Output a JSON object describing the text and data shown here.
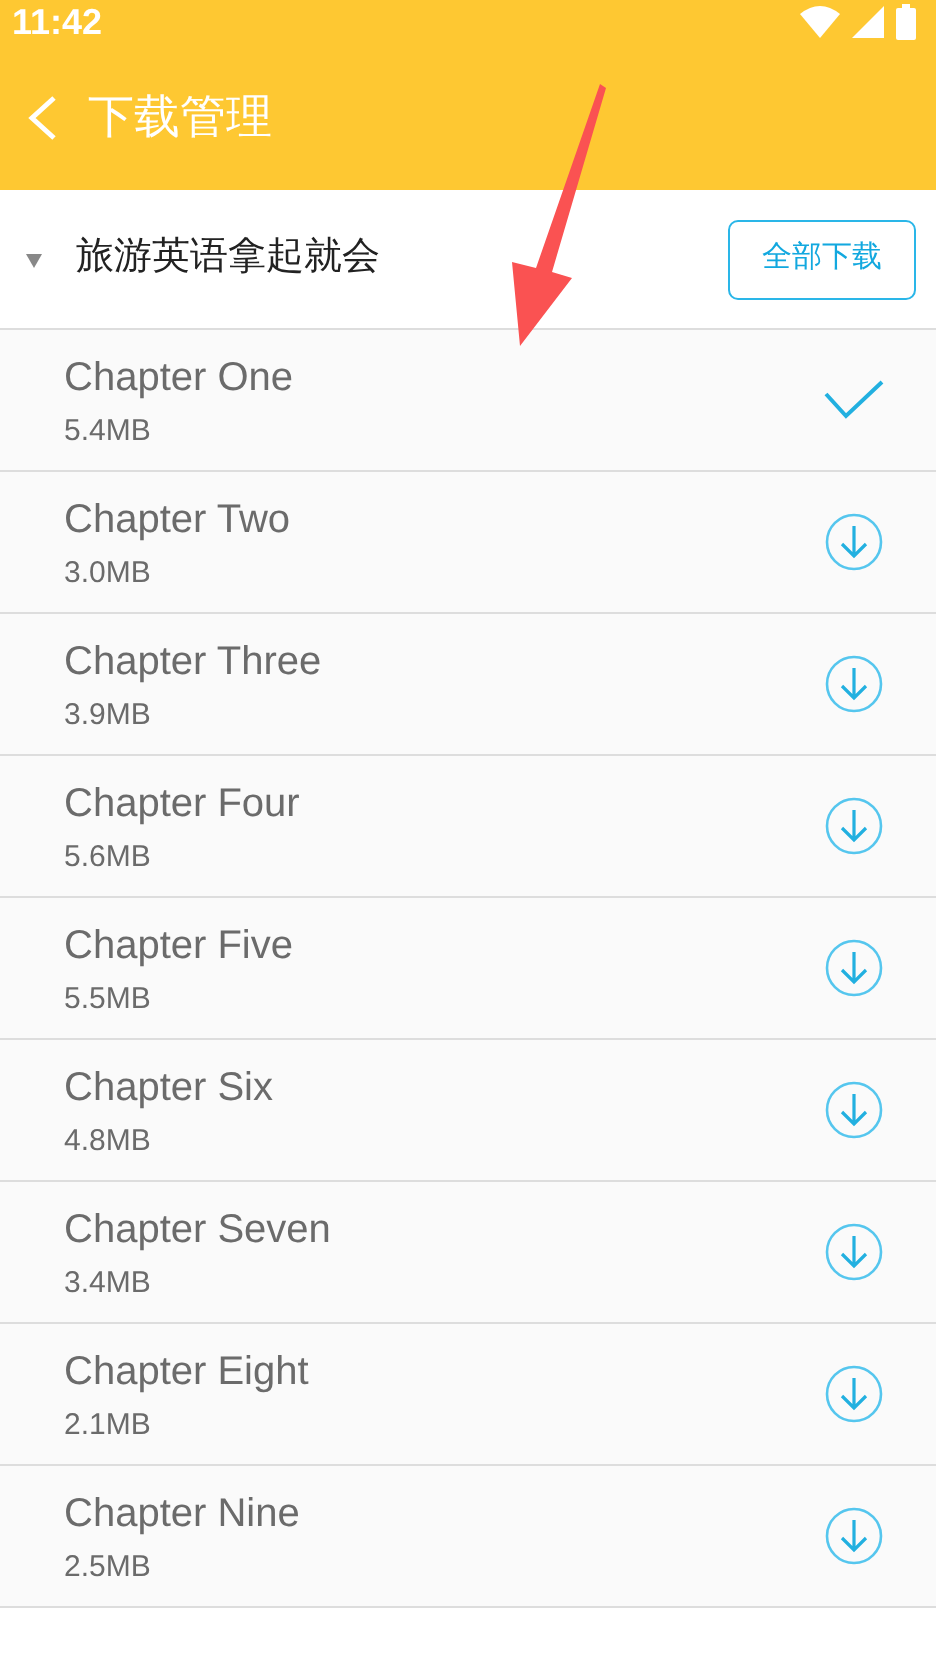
{
  "status_bar": {
    "time": "11:42"
  },
  "app_bar": {
    "title": "下载管理"
  },
  "group": {
    "title": "旅游英语拿起就会",
    "expanded": true,
    "action": "全部下载"
  },
  "chapters": [
    {
      "title": "Chapter One",
      "size": "5.4MB",
      "downloaded": true
    },
    {
      "title": "Chapter Two",
      "size": "3.0MB",
      "downloaded": false
    },
    {
      "title": "Chapter Three",
      "size": "3.9MB",
      "downloaded": false
    },
    {
      "title": "Chapter Four",
      "size": "5.6MB",
      "downloaded": false
    },
    {
      "title": "Chapter Five",
      "size": "5.5MB",
      "downloaded": false
    },
    {
      "title": "Chapter Six",
      "size": "4.8MB",
      "downloaded": false
    },
    {
      "title": "Chapter Seven",
      "size": "3.4MB",
      "downloaded": false
    },
    {
      "title": "Chapter Eight",
      "size": "2.1MB",
      "downloaded": false
    },
    {
      "title": "Chapter Nine",
      "size": "2.5MB",
      "downloaded": false
    }
  ]
}
